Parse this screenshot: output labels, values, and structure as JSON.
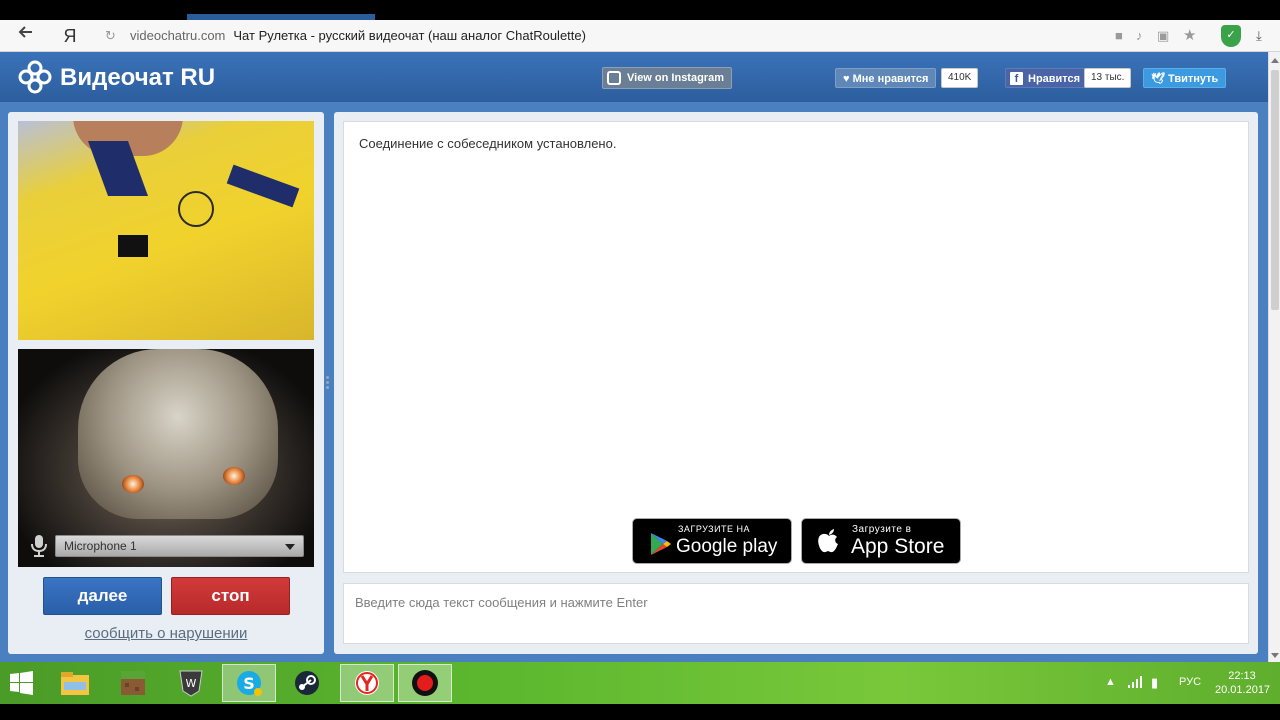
{
  "browser": {
    "back_icon": "back-arrow-icon",
    "yandex_logo": "Я",
    "reload_icon": "reload-icon",
    "domain": "videochatru.com",
    "page_title": "Чат Рулетка - русский видеочат (наш аналог ChatRoulette)"
  },
  "site": {
    "brand": "Видеочат RU",
    "instagram_label": "View on Instagram",
    "like_label": "Мне нравится",
    "like_count": "410K",
    "fb_label": "Нравится",
    "fb_count": "13 тыс.",
    "tweet_label": "Твитнуть",
    "colors": {
      "header": "#2d5e9e",
      "next": "#2a5fa8",
      "stop": "#b82a2a"
    }
  },
  "left": {
    "microphone": "Microphone 1",
    "next_label": "далее",
    "stop_label": "стоп",
    "report_label": "сообщить о нарушении"
  },
  "chat": {
    "status_message": "Соединение с собеседником установлено.",
    "google_small": "ЗАГРУЗИТЕ НА",
    "google_big": "Google play",
    "apple_small": "Загрузите в",
    "apple_big": "App Store",
    "input_placeholder": "Введите сюда текст сообщения и нажмите Enter"
  },
  "taskbar": {
    "apps": [
      "windows-start-icon",
      "file-explorer-icon",
      "minecraft-icon",
      "world-of-tanks-icon",
      "skype-icon",
      "steam-icon",
      "yandex-browser-icon",
      "recorder-icon"
    ],
    "language": "РУС",
    "time": "22:13",
    "date": "20.01.2017"
  }
}
